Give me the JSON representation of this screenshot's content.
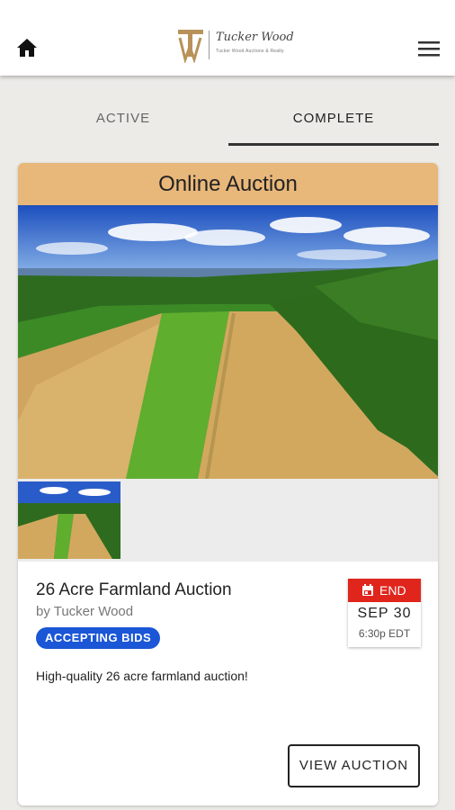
{
  "header": {
    "home_icon": "home-icon",
    "menu_icon": "hamburger-menu-icon",
    "logo": {
      "monogram": "TW",
      "script_text": "Tucker Wood",
      "tagline": "Tucker Wood Auctions & Realty",
      "color": "#b8925a"
    }
  },
  "tabs": [
    {
      "label": "ACTIVE",
      "selected": false
    },
    {
      "label": "COMPLETE",
      "selected": true
    }
  ],
  "auction": {
    "banner": "Online Auction",
    "banner_color": "#e8b77a",
    "title": "26 Acre Farmland Auction",
    "byline": "by Tucker Wood",
    "status_badge": "ACCEPTING BIDS",
    "status_color": "#1a56d6",
    "description": "High-quality 26 acre farmland auction!",
    "end_date": {
      "label": "END",
      "icon": "calendar-icon",
      "day": "SEP 30",
      "time": "6:30p EDT",
      "color": "#e0251d"
    },
    "view_button": "VIEW AUCTION"
  }
}
